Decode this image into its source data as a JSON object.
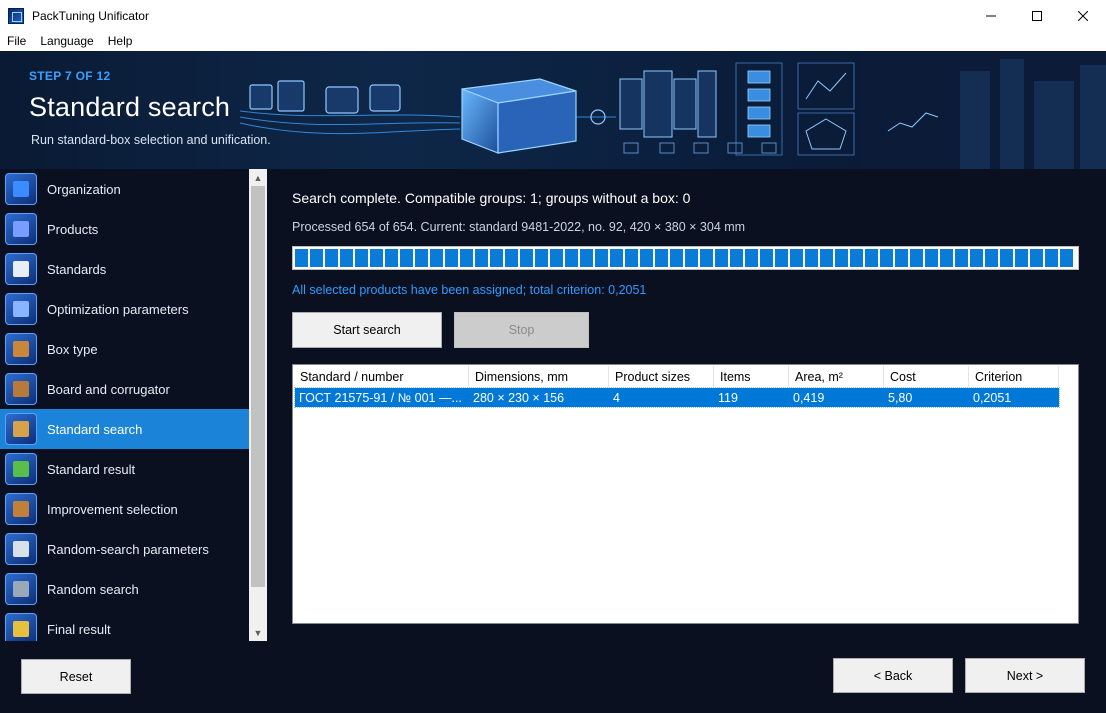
{
  "window": {
    "title": "PackTuning Unificator",
    "controls": {
      "minimize": "—",
      "maximize": "☐",
      "close": "✕"
    }
  },
  "menu": [
    "File",
    "Language",
    "Help"
  ],
  "banner": {
    "step": "STEP 7 OF 12",
    "title": "Standard search",
    "subtitle": "Run standard-box selection and unification."
  },
  "sidebar": {
    "items": [
      {
        "label": "Organization",
        "icon": "organization-icon",
        "color": "#3c8cff"
      },
      {
        "label": "Products",
        "icon": "products-icon",
        "color": "#7a9cff"
      },
      {
        "label": "Standards",
        "icon": "standards-icon",
        "color": "#e8eef8"
      },
      {
        "label": "Optimization parameters",
        "icon": "optimization-icon",
        "color": "#8ab4ff"
      },
      {
        "label": "Box type",
        "icon": "box-type-icon",
        "color": "#c8873a"
      },
      {
        "label": "Board and corrugator",
        "icon": "board-icon",
        "color": "#b77a3b"
      },
      {
        "label": "Standard search",
        "icon": "standard-search-icon",
        "color": "#d6a24a"
      },
      {
        "label": "Standard result",
        "icon": "standard-result-icon",
        "color": "#58c04a"
      },
      {
        "label": "Improvement selection",
        "icon": "improvement-icon",
        "color": "#c0803a"
      },
      {
        "label": "Random-search parameters",
        "icon": "random-params-icon",
        "color": "#d8e0ea"
      },
      {
        "label": "Random search",
        "icon": "random-search-icon",
        "color": "#9aa8ba"
      },
      {
        "label": "Final result",
        "icon": "final-result-icon",
        "color": "#e8c040"
      }
    ],
    "active_index": 6
  },
  "main": {
    "status_heading": "Search complete. Compatible groups: 1; groups without a box: 0",
    "processed": "Processed 654 of 654. Current: standard 9481-2022, no. 92, 420 × 380 × 304 mm",
    "progress_fraction": 1.0,
    "result_note": "All selected products have been assigned; total criterion: 0,2051",
    "start_button": "Start search",
    "stop_button": "Stop",
    "table": {
      "columns": [
        "Standard / number",
        "Dimensions, mm",
        "Product sizes",
        "Items",
        "Area, m²",
        "Cost",
        "Criterion"
      ],
      "rows": [
        [
          "ГОСТ 21575-91 / № 001 —...",
          "280 × 230 × 156",
          "4",
          "119",
          "0,419",
          "5,80",
          "0,2051"
        ]
      ]
    }
  },
  "footer": {
    "reset": "Reset",
    "back": "< Back",
    "next": "Next >"
  },
  "colors": {
    "accent": "#1c84d8",
    "step_label": "#3aa0ff",
    "progress": "#0b7bd8",
    "dark_bg": "#0a1020"
  }
}
